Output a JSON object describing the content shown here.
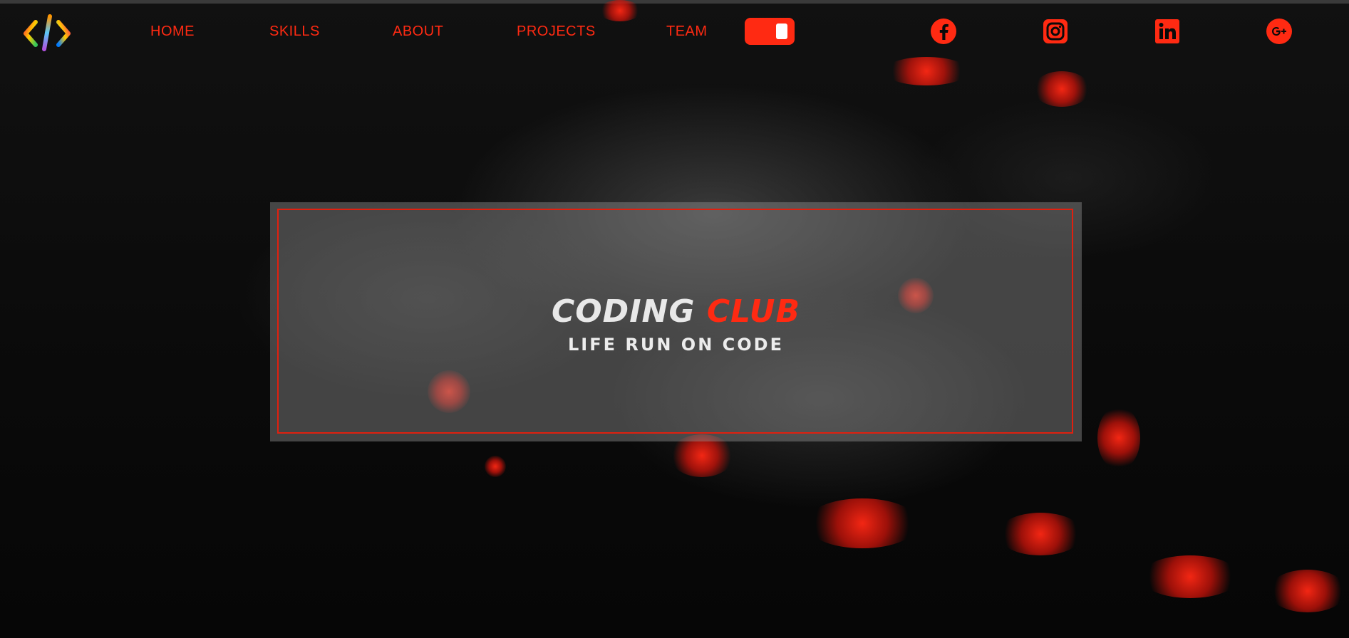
{
  "nav": {
    "logo_icon": "code-brackets-icon",
    "links": [
      "HOME",
      "SKILLS",
      "ABOUT",
      "PROJECTS",
      "TEAM"
    ],
    "theme_toggle_state": "on",
    "social_icons": [
      "facebook-icon",
      "instagram-icon",
      "linkedin-icon",
      "google-plus-icon"
    ]
  },
  "hero": {
    "title_part1": "CODING",
    "title_part2": "CLUB",
    "subtitle": "LIFE RUN ON CODE"
  },
  "colors": {
    "accent": "#ff2a12",
    "background": "#050505",
    "hero_panel": "#8a8a8a",
    "title_light": "#e8e8e8"
  }
}
